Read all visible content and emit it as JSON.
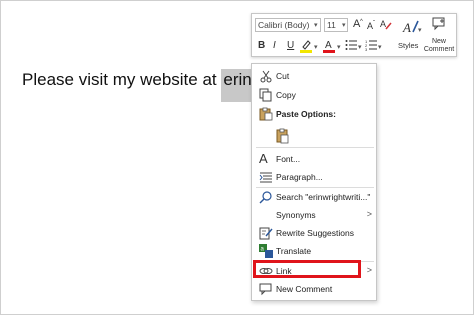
{
  "document": {
    "text_before": "Please visit my website at ",
    "selected_text": "erinwri"
  },
  "mini_toolbar": {
    "font_name": "Calibri (Body)",
    "font_size": "11",
    "grow_font": "A",
    "shrink_font": "A",
    "bold": "B",
    "italic": "I",
    "underline": "U",
    "font_color": "A",
    "styles_label": "Styles",
    "new_comment_label": "New Comment"
  },
  "context_menu": {
    "cut": "Cut",
    "copy": "Copy",
    "paste_options": "Paste Options:",
    "font": "Font...",
    "paragraph": "Paragraph...",
    "search": "Search \"erinwrightwriti...\"",
    "synonyms": "Synonyms",
    "rewrite": "Rewrite Suggestions",
    "translate": "Translate",
    "link": "Link",
    "new_comment": "New Comment"
  },
  "colors": {
    "highlight_box": "#e0141b",
    "selection": "#c8c8c8"
  }
}
